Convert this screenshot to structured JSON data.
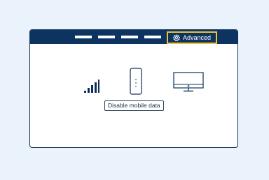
{
  "header": {
    "nav_items": [
      "",
      "",
      "",
      ""
    ],
    "advanced": {
      "label": "Advanced",
      "icon": "gear-icon"
    }
  },
  "main": {
    "icons": [
      "mobile-signal-icon",
      "router-icon",
      "monitor-icon"
    ],
    "tooltip": "Disable mobile data"
  },
  "colors": {
    "header_bg": "#0d3461",
    "highlight": "#f2c230",
    "page_bg": "#eaf3fb"
  }
}
